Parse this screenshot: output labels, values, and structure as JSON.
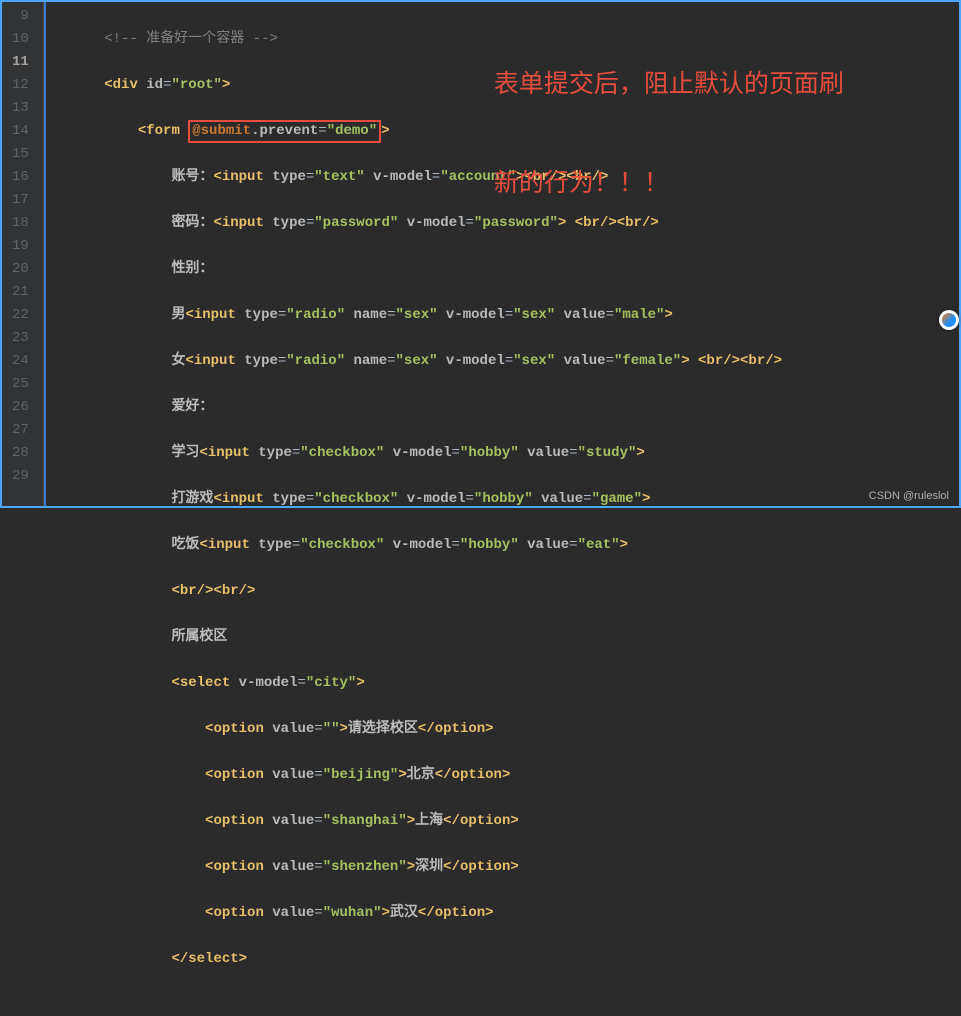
{
  "gutter": [
    "9",
    "10",
    "11",
    "12",
    "13",
    "14",
    "15",
    "16",
    "17",
    "18",
    "19",
    "20",
    "21",
    "22",
    "23",
    "24",
    "25",
    "26",
    "27",
    "28",
    "29"
  ],
  "activeLine": "11",
  "annotation": {
    "l1": "表单提交后，阻止默认的页面刷",
    "l2": "新的行为！！！"
  },
  "watermark": "CSDN @ruleslol",
  "code": {
    "l9_cmt": "<!-- 准备好一个容器 -->",
    "l10_a": "<",
    "l10_tag": "div",
    "l10_attr": " id",
    "l10_eq": "=",
    "l10_val": "\"root\"",
    "l10_b": ">",
    "l11_a": "<",
    "l11_tag": "form",
    "l11_sp": " ",
    "l11_box_attr": "@submit",
    "l11_box_dot": ".",
    "l11_box_prev": "prevent",
    "l11_box_eq": "=",
    "l11_box_val": "\"demo\"",
    "l11_b": ">",
    "l12_txt": "账号：",
    "l12_a": "<",
    "l12_tag": "input",
    "l12_attr1": " type",
    "l12_eq1": "=",
    "l12_val1": "\"text\"",
    "l12_attr2": " v-model",
    "l12_eq2": "=",
    "l12_val2": "\"account\"",
    "l12_b": ">",
    "l12_br": "<br/><br/>",
    "l13_txt": "密码：",
    "l13_a": "<",
    "l13_tag": "input",
    "l13_attr1": " type",
    "l13_eq1": "=",
    "l13_val1": "\"password\"",
    "l13_attr2": " v-model",
    "l13_eq2": "=",
    "l13_val2": "\"password\"",
    "l13_b": ">",
    "l13_br": " <br/><br/>",
    "l14_txt": "性别：",
    "l15_txt": "男",
    "l15_a": "<",
    "l15_tag": "input",
    "l15_attr1": " type",
    "l15_eq1": "=",
    "l15_val1": "\"radio\"",
    "l15_attr2": " name",
    "l15_eq2": "=",
    "l15_val2": "\"sex\"",
    "l15_attr3": " v-model",
    "l15_eq3": "=",
    "l15_val3": "\"sex\"",
    "l15_attr4": " value",
    "l15_eq4": "=",
    "l15_val4": "\"male\"",
    "l15_b": ">",
    "l16_txt": "女",
    "l16_a": "<",
    "l16_tag": "input",
    "l16_attr1": " type",
    "l16_eq1": "=",
    "l16_val1": "\"radio\"",
    "l16_attr2": " name",
    "l16_eq2": "=",
    "l16_val2": "\"sex\"",
    "l16_attr3": " v-model",
    "l16_eq3": "=",
    "l16_val3": "\"sex\"",
    "l16_attr4": " value",
    "l16_eq4": "=",
    "l16_val4": "\"female\"",
    "l16_b": ">",
    "l16_br": " <br/><br/>",
    "l17_txt": "爱好：",
    "l18_txt": "学习",
    "l18_a": "<",
    "l18_tag": "input",
    "l18_attr1": " type",
    "l18_eq1": "=",
    "l18_val1": "\"checkbox\"",
    "l18_attr2": " v-model",
    "l18_eq2": "=",
    "l18_val2": "\"hobby\"",
    "l18_attr3": " value",
    "l18_eq3": "=",
    "l18_val3": "\"study\"",
    "l18_b": ">",
    "l19_txt": "打游戏",
    "l19_a": "<",
    "l19_tag": "input",
    "l19_attr1": " type",
    "l19_eq1": "=",
    "l19_val1": "\"checkbox\"",
    "l19_attr2": " v-model",
    "l19_eq2": "=",
    "l19_val2": "\"hobby\"",
    "l19_attr3": " value",
    "l19_eq3": "=",
    "l19_val3": "\"game\"",
    "l19_b": ">",
    "l20_txt": "吃饭",
    "l20_a": "<",
    "l20_tag": "input",
    "l20_attr1": " type",
    "l20_eq1": "=",
    "l20_val1": "\"checkbox\"",
    "l20_attr2": " v-model",
    "l20_eq2": "=",
    "l20_val2": "\"hobby\"",
    "l20_attr3": " value",
    "l20_eq3": "=",
    "l20_val3": "\"eat\"",
    "l20_b": ">",
    "l21_br": "<br/><br/>",
    "l22_txt": "所属校区",
    "l23_a": "<",
    "l23_tag": "select",
    "l23_attr": " v-model",
    "l23_eq": "=",
    "l23_val": "\"city\"",
    "l23_b": ">",
    "l24_a": "<",
    "l24_tag": "option",
    "l24_attr": " value",
    "l24_eq": "=",
    "l24_val": "\"\"",
    "l24_b": ">",
    "l24_txt": "请选择校区",
    "l24_c": "</",
    "l24_tag2": "option",
    "l24_d": ">",
    "l25_a": "<",
    "l25_tag": "option",
    "l25_attr": " value",
    "l25_eq": "=",
    "l25_val": "\"beijing\"",
    "l25_b": ">",
    "l25_txt": "北京",
    "l25_c": "</",
    "l25_tag2": "option",
    "l25_d": ">",
    "l26_a": "<",
    "l26_tag": "option",
    "l26_attr": " value",
    "l26_eq": "=",
    "l26_val": "\"shanghai\"",
    "l26_b": ">",
    "l26_txt": "上海",
    "l26_c": "</",
    "l26_tag2": "option",
    "l26_d": ">",
    "l27_a": "<",
    "l27_tag": "option",
    "l27_attr": " value",
    "l27_eq": "=",
    "l27_val": "\"shenzhen\"",
    "l27_b": ">",
    "l27_txt": "深圳",
    "l27_c": "</",
    "l27_tag2": "option",
    "l27_d": ">",
    "l28_a": "<",
    "l28_tag": "option",
    "l28_attr": " value",
    "l28_eq": "=",
    "l28_val": "\"wuhan\"",
    "l28_b": ">",
    "l28_txt": "武汉",
    "l28_c": "</",
    "l28_tag2": "option",
    "l28_d": ">",
    "l29_a": "</",
    "l29_tag": "select",
    "l29_b": ">"
  }
}
